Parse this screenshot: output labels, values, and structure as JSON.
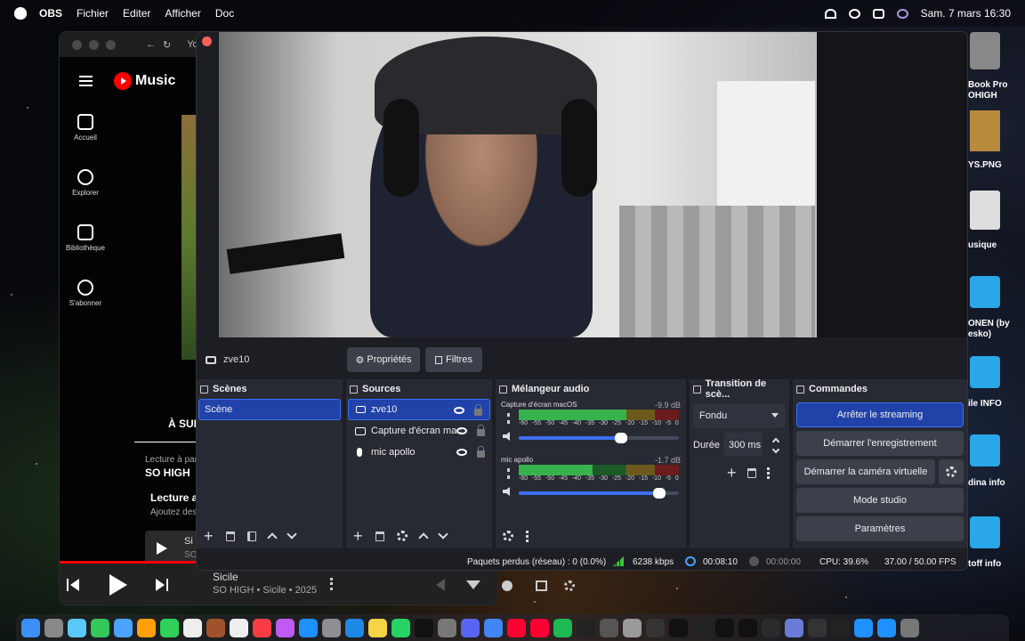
{
  "menubar": {
    "app": "OBS",
    "items": [
      "Fichier",
      "Editer",
      "Afficher",
      "Doc"
    ],
    "datetime": "Sam. 7 mars  16:30"
  },
  "ytmusic": {
    "tab_title": "Yo",
    "logo": "Music",
    "nav": [
      "Accueil",
      "Explorer",
      "Bibliothèque",
      "S'abonner"
    ],
    "up_next": "À SUIV",
    "playing_from": "Lecture à par",
    "playing_from_name": "SO HIGH",
    "autoplay_title": "Lecture au",
    "autoplay_sub": "Ajoutez des",
    "card_text": "Si",
    "card_sub": "SO",
    "player_title": "Sicile",
    "player_sub": "SO HIGH • Sicile • 2025"
  },
  "desktop": {
    "items": [
      "Book Pro",
      "OHIGH",
      "YS.PNG",
      "usique",
      "ONEN (by",
      "esko)",
      "ile INFO",
      "dina info",
      "toff info"
    ]
  },
  "obs": {
    "source_name": "zve10",
    "properties_btn": "Propriétés",
    "filters_btn": "Filtres",
    "scenes": {
      "title": "Scènes",
      "items": [
        "Scène"
      ]
    },
    "sources": {
      "title": "Sources",
      "items": [
        "zve10",
        "Capture d'écran mac",
        "mic apollo"
      ]
    },
    "mixer": {
      "title": "Mélangeur audio",
      "scale": [
        "-60",
        "-55",
        "-50",
        "-45",
        "-40",
        "-35",
        "-30",
        "-25",
        "-20",
        "-15",
        "-10",
        "-5",
        "0"
      ],
      "channels": [
        {
          "name": "Capture d'écran macOS",
          "db": "-9.9 dB",
          "level": 0.67,
          "volume": 0.64
        },
        {
          "name": "mic apollo",
          "db": "-1.7 dB",
          "level": 0.46,
          "volume": 0.88
        }
      ]
    },
    "transition": {
      "title": "Transition de scè...",
      "type": "Fondu",
      "duration_label": "Durée",
      "duration": "300 ms"
    },
    "controls": {
      "title": "Commandes",
      "stop_stream": "Arrêter le streaming",
      "start_rec": "Démarrer l'enregistrement",
      "virtual_cam": "Démarrer la caméra virtuelle",
      "studio": "Mode studio",
      "settings": "Paramètres"
    },
    "status": {
      "dropped": "Paquets perdus (réseau) : 0 (0.0%)",
      "bitrate": "6238 kbps",
      "stream_time": "00:08:10",
      "rec_time": "00:00:00",
      "cpu": "CPU: 39.6%",
      "fps": "37.00 / 50.00 FPS"
    }
  },
  "colors": {
    "obs_bg": "#1d1e24",
    "panel": "#272a33",
    "accent": "#2143a9",
    "yt_red": "#ff0000"
  }
}
